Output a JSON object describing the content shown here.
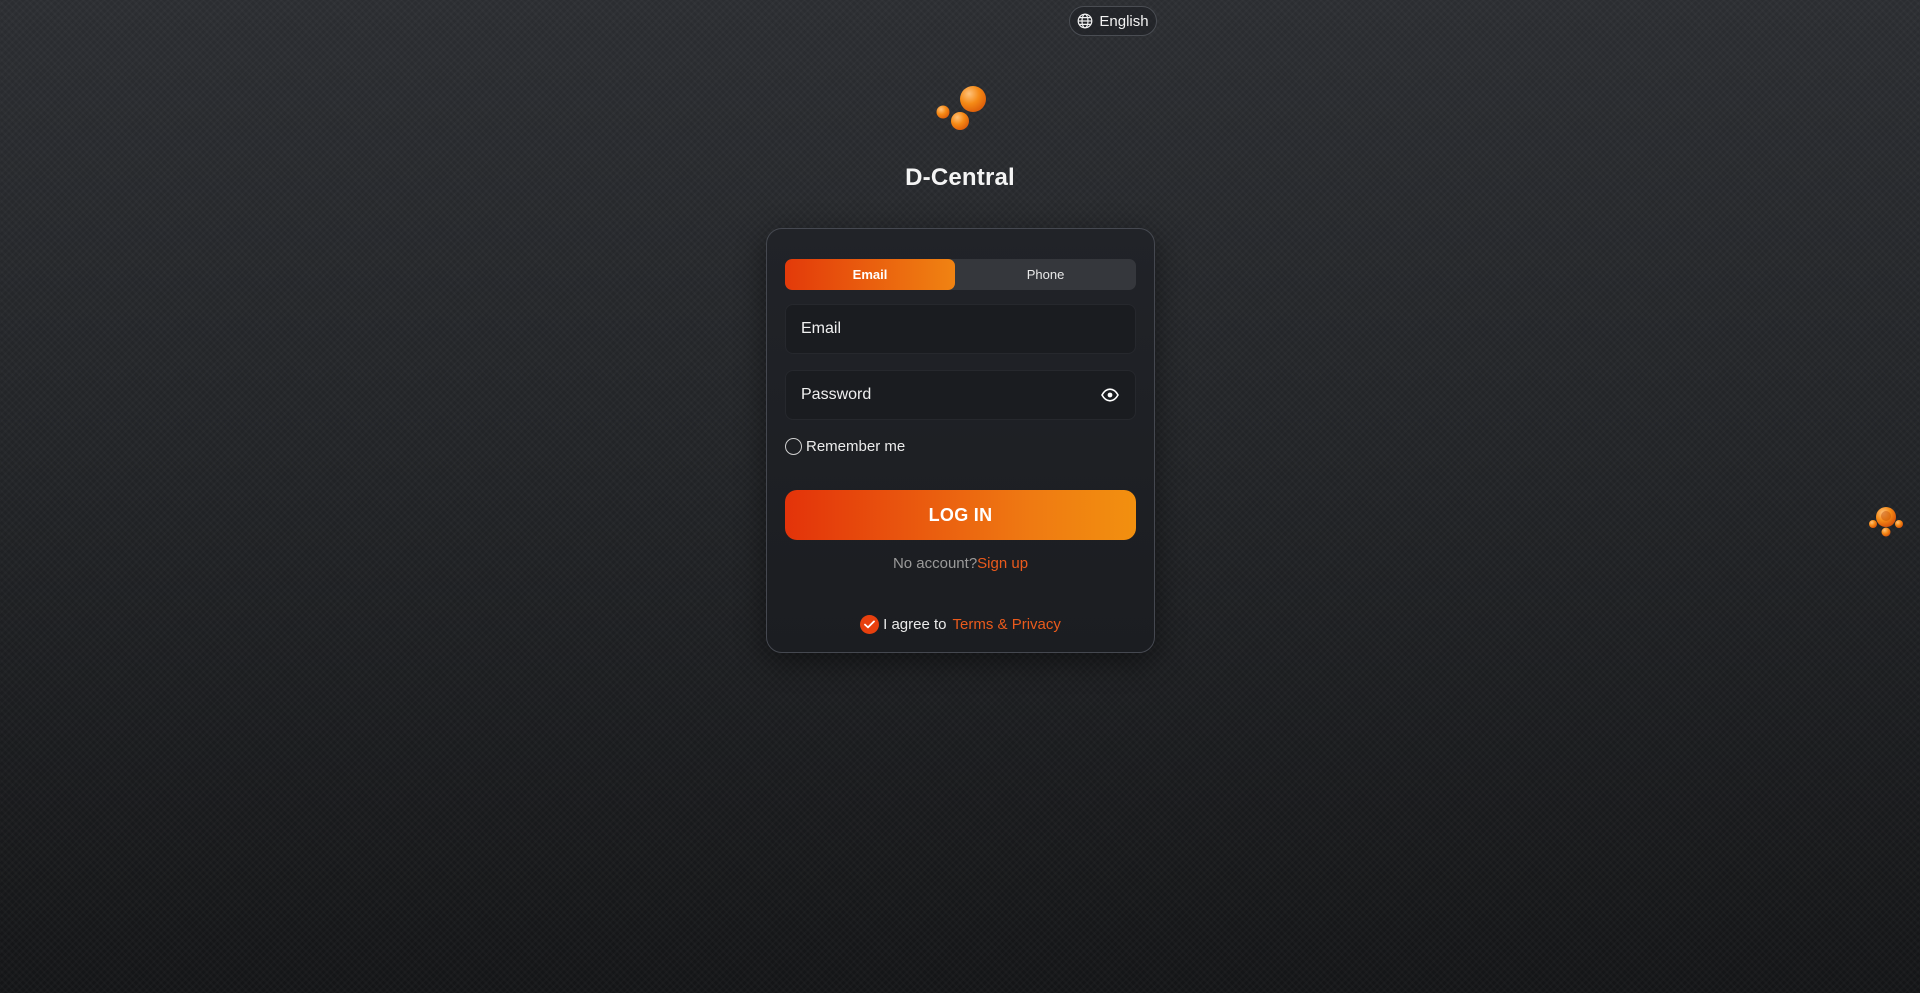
{
  "language": {
    "label": "English",
    "icon": "globe-icon"
  },
  "brand": {
    "name": "D-Central",
    "logo_icon": "orange-bubbles-logo",
    "accent": "#f08312",
    "accent_dark": "#e33a0a"
  },
  "tabs": [
    {
      "label": "Email",
      "active": true
    },
    {
      "label": "Phone",
      "active": false
    }
  ],
  "form": {
    "email": {
      "placeholder": "Email",
      "value": ""
    },
    "password": {
      "placeholder": "Password",
      "value": "",
      "toggle_icon": "eye-icon"
    },
    "remember_label": "Remember me",
    "remember_checked": false,
    "submit_label": "LOG IN"
  },
  "signup": {
    "prompt": "No account?",
    "link_label": "Sign up"
  },
  "terms": {
    "checked": true,
    "text": "I agree to",
    "link_label": "Terms & Privacy"
  },
  "floating_widget": {
    "icon": "support-bubbles-icon"
  }
}
